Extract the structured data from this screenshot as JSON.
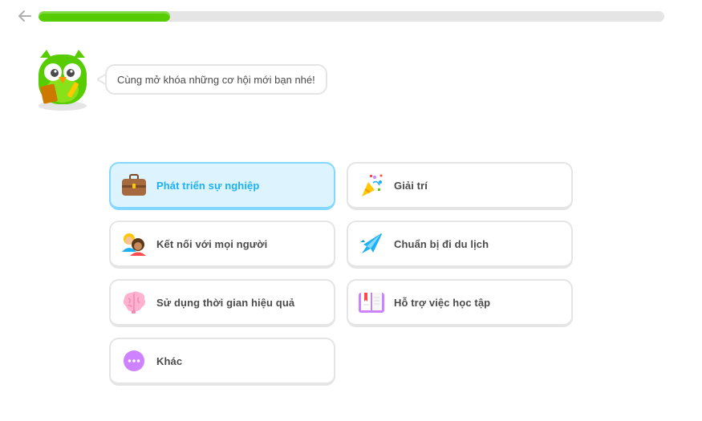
{
  "progress": {
    "fraction": 0.21,
    "color": "#58cc02"
  },
  "mascot": {
    "speech": "Cùng mở khóa những cơ hội mới bạn nhé!"
  },
  "options": [
    {
      "label": "Phát triển sự nghiệp",
      "icon": "briefcase-icon",
      "selected": true
    },
    {
      "label": "Giải trí",
      "icon": "party-popper-icon",
      "selected": false
    },
    {
      "label": "Kết nối với mọi người",
      "icon": "people-icon",
      "selected": false
    },
    {
      "label": "Chuẩn bị đi du lịch",
      "icon": "airplane-icon",
      "selected": false
    },
    {
      "label": "Sử dụng thời gian hiệu quả",
      "icon": "brain-icon",
      "selected": false
    },
    {
      "label": "Hỗ trợ việc học tập",
      "icon": "book-icon",
      "selected": false
    },
    {
      "label": "Khác",
      "icon": "more-dots-icon",
      "selected": false
    }
  ],
  "colors": {
    "selected_bg": "#ddf4ff",
    "selected_border": "#84d8ff",
    "selected_text": "#1cb0f6",
    "text": "#4b4b4b"
  }
}
